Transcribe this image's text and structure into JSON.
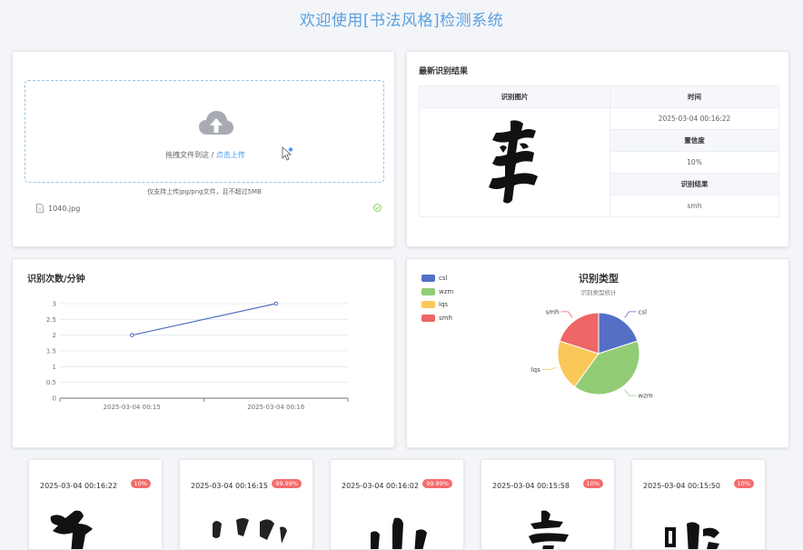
{
  "page": {
    "title": "欢迎使用[书法风格]检测系统"
  },
  "upload": {
    "text": "拖拽文件到这 / ",
    "link": "点击上传",
    "tip": "仅支持上传jpg/png文件，且不超过5MB",
    "file_name": "1040.jpg"
  },
  "result": {
    "title": "最新识别结果",
    "image_header": "识别图片",
    "time_header": "时间",
    "time_value": "2025-03-04 00:16:22",
    "confidence_header": "置信度",
    "confidence_value": "10%",
    "result_header": "识别结果",
    "result_value": "smh"
  },
  "line_chart": {
    "title": "识别次数/分钟"
  },
  "pie_chart": {
    "title": "识别类型",
    "subtitle": "识别类型统计"
  },
  "history": [
    {
      "time": "2025-03-04 00:16:22",
      "confidence": "10%"
    },
    {
      "time": "2025-03-04 00:16:15",
      "confidence": "99.99%"
    },
    {
      "time": "2025-03-04 00:16:02",
      "confidence": "99.99%"
    },
    {
      "time": "2025-03-04 00:15:58",
      "confidence": "10%"
    },
    {
      "time": "2025-03-04 00:15:50",
      "confidence": "10%"
    }
  ],
  "colors": {
    "accent": "#409eff",
    "title": "#5aa0e0",
    "badge": "#f56c6c",
    "line": "#5470c6"
  },
  "chart_data": [
    {
      "type": "line",
      "x": [
        "2025-03-04 00:15",
        "2025-03-04 00:16"
      ],
      "series": [
        {
          "values": [
            2,
            3
          ]
        }
      ],
      "ylim": [
        0,
        3
      ],
      "yticks": [
        "0",
        "0.5",
        "1",
        "1.5",
        "2",
        "2.5",
        "3"
      ],
      "grid": true
    },
    {
      "type": "pie",
      "categories": [
        "csl",
        "wzm",
        "lqs",
        "smh"
      ],
      "values": [
        1,
        2,
        1,
        1
      ],
      "colors": [
        "#5470c6",
        "#91cc75",
        "#fac858",
        "#ee6666"
      ],
      "legend": "top-left"
    }
  ]
}
